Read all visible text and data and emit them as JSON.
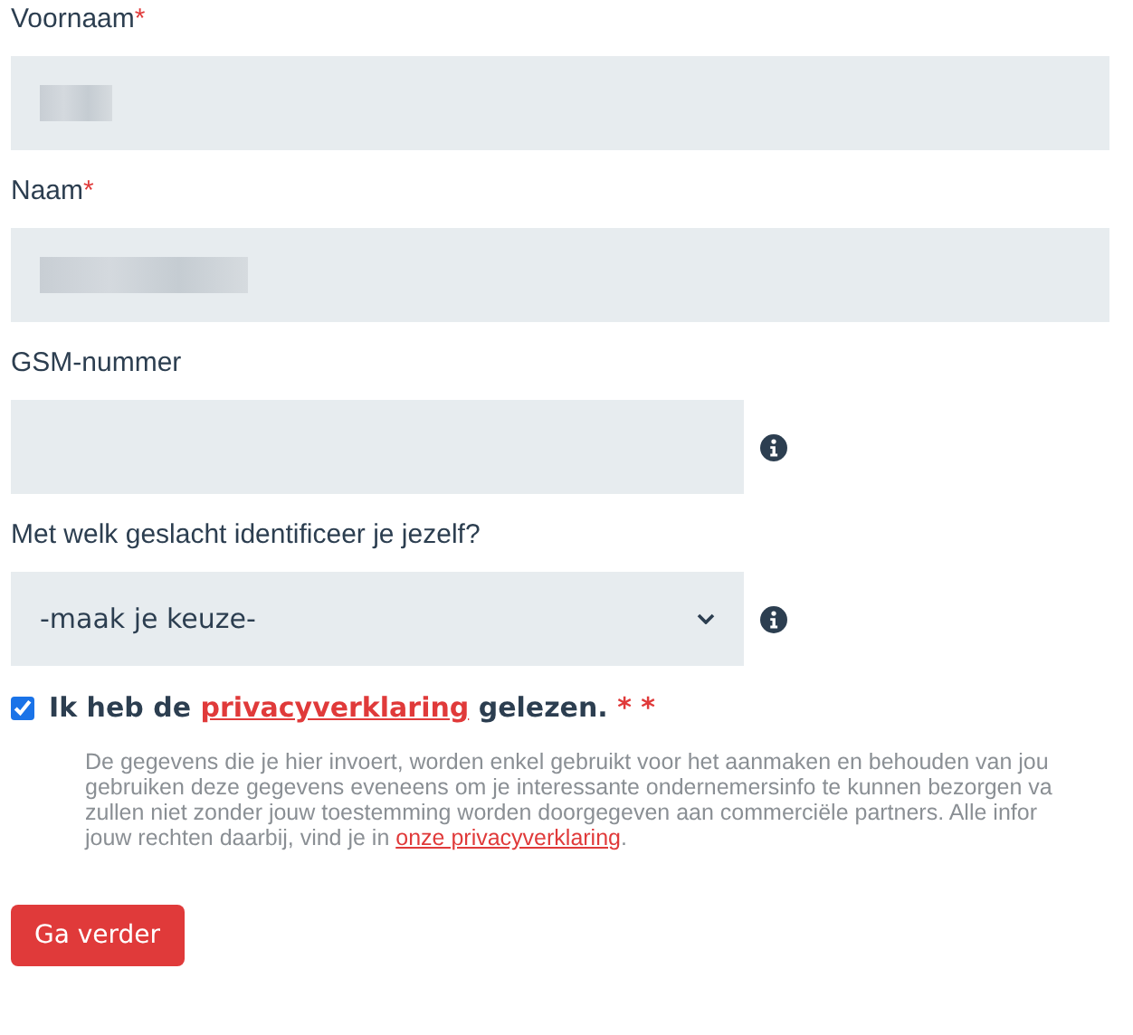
{
  "fields": [
    {
      "kind": "text",
      "label": "Voornaam",
      "required_mark": "*",
      "redacted": true,
      "info": false,
      "wide": true
    },
    {
      "kind": "text",
      "label": "Naam",
      "required_mark": "*",
      "redacted": true,
      "info": false,
      "wide": true
    },
    {
      "kind": "text",
      "label": "GSM-nummer",
      "redacted": false,
      "info": true,
      "wide": false
    },
    {
      "kind": "select",
      "label": "Met welk geslacht identificeer je jezelf?",
      "value": "-maak je keuze-",
      "info": true,
      "wide": false
    }
  ],
  "consent": {
    "checked": true,
    "before": "Ik heb de",
    "link": "privacyverklaring",
    "after": "gelezen.",
    "required_mark": "* *",
    "lines": [
      "De gegevens die je hier invoert, worden enkel gebruikt voor het aanmaken en behouden van jou",
      "gebruiken deze gegevens eveneens om je interessante ondernemersinfo te kunnen bezorgen va",
      "zullen niet zonder jouw toestemming worden doorgegeven aan commerciële partners. Alle infor"
    ],
    "last_line": "jouw rechten daarbij, vind je in",
    "last_link": "onze privacyverklaring",
    "last_end": "."
  },
  "submit": "Ga verder"
}
